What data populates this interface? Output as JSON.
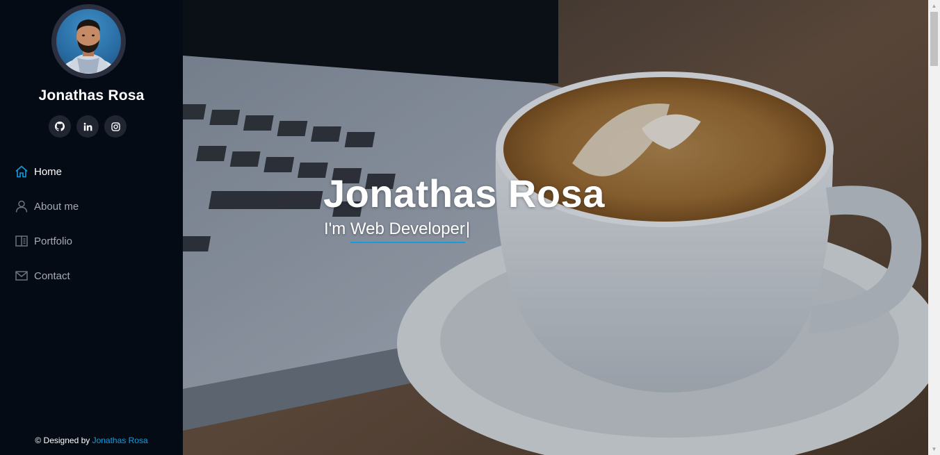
{
  "profile": {
    "name": "Jonathas Rosa"
  },
  "social": [
    {
      "name": "github-icon"
    },
    {
      "name": "linkedin-icon"
    },
    {
      "name": "instagram-icon"
    }
  ],
  "nav": [
    {
      "label": "Home",
      "icon": "home-icon",
      "active": true
    },
    {
      "label": "About me",
      "icon": "user-icon",
      "active": false
    },
    {
      "label": "Portfolio",
      "icon": "book-icon",
      "active": false
    },
    {
      "label": "Contact",
      "icon": "envelope-icon",
      "active": false
    }
  ],
  "footer": {
    "prefix": "© Designed by ",
    "link": "Jonathas Rosa"
  },
  "hero": {
    "title": "Jonathas Rosa",
    "subtitle_prefix": "I'm ",
    "typed": "Web Developer",
    "cursor": "|"
  },
  "colors": {
    "accent": "#149ddd",
    "sidebar_bg": "#040b14",
    "social_bg": "#212431"
  }
}
